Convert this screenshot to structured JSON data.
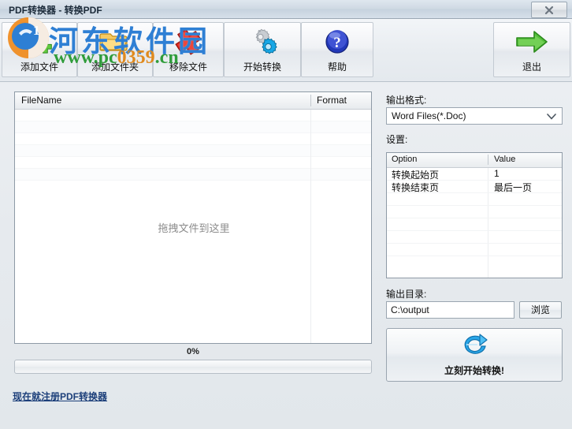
{
  "window": {
    "title": "PDF转换器 - 转换PDF",
    "close_icon": "close-icon",
    "close_label": "×"
  },
  "toolbar": {
    "buttons": [
      {
        "label": "添加文件",
        "icon": "add-file-icon"
      },
      {
        "label": "添加文件夹",
        "icon": "add-folder-icon"
      },
      {
        "label": "移除文件",
        "icon": "remove-file-icon"
      },
      {
        "label": "开始转换",
        "icon": "gears-icon"
      },
      {
        "label": "帮助",
        "icon": "help-icon"
      }
    ],
    "exit": {
      "label": "退出",
      "icon": "green-arrow-right-icon"
    }
  },
  "file_list": {
    "columns": [
      "FileName",
      "Format"
    ],
    "rows": [],
    "drop_hint": "拖拽文件到这里"
  },
  "progress": {
    "percent_label": "0%",
    "value": 0
  },
  "register_link": "现在就注册PDF转换器",
  "right_panel": {
    "format_label": "输出格式:",
    "format_value": "Word Files(*.Doc)",
    "format_options": [
      "Word Files(*.Doc)"
    ],
    "settings_label": "设置:",
    "settings_columns": [
      "Option",
      "Value"
    ],
    "settings_rows": [
      {
        "option": "转换起始页",
        "value": "1"
      },
      {
        "option": "转换结束页",
        "value": "最后一页"
      }
    ],
    "outdir_label": "输出目录:",
    "outdir_value": "C:\\output",
    "outdir_placeholder": "C:\\output",
    "browse_label": "浏览",
    "convert_label": "立刻开始转换!",
    "convert_icon": "blue-refresh-arrow-icon"
  },
  "watermark": {
    "site_name": "河东软件园",
    "url_green_1": "www.pc",
    "url_orange": "0359",
    "url_green_2": ".cn"
  },
  "colors": {
    "accent_blue": "#2e7fd4",
    "link": "#1c3f7a",
    "green": "#2f9c3a",
    "orange": "#e08a1e",
    "window_bg": "#e8ecef"
  }
}
